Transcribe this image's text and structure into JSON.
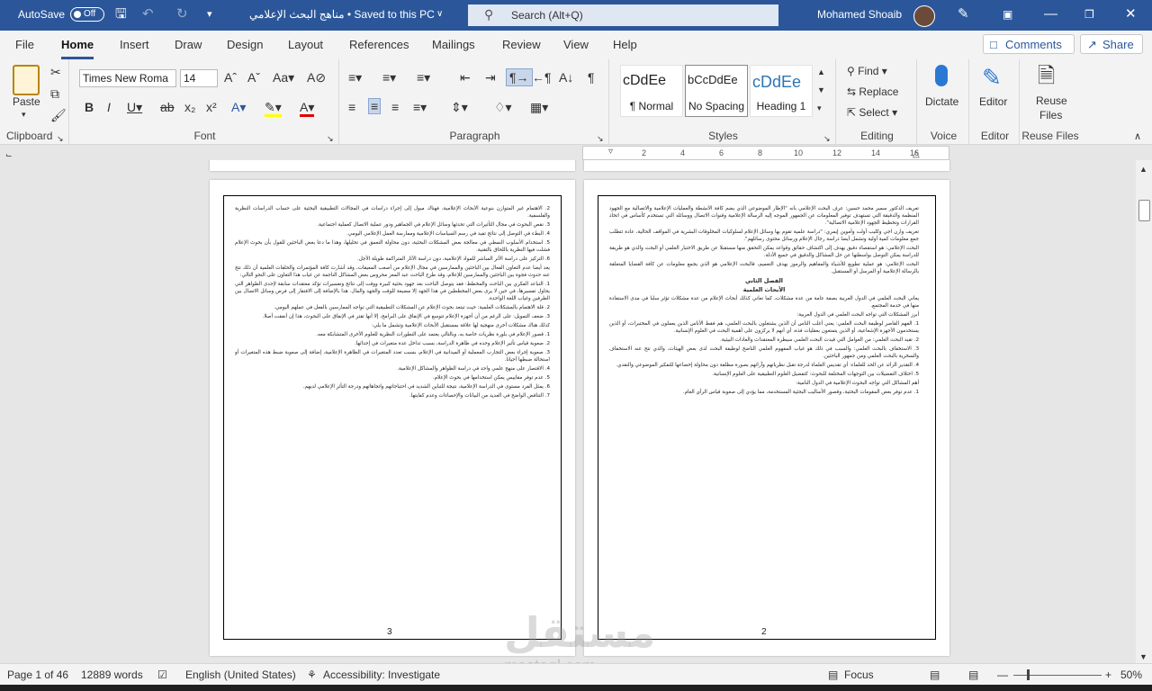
{
  "titlebar": {
    "autosave_label": "AutoSave",
    "autosave_state": "Off",
    "doc_title": "مناهج البحث الإعلامي • Saved to this PC",
    "search_placeholder": "Search (Alt+Q)",
    "user_name": "Mohamed Shoaib"
  },
  "tabs": [
    "File",
    "Home",
    "Insert",
    "Draw",
    "Design",
    "Layout",
    "References",
    "Mailings",
    "Review",
    "View",
    "Help"
  ],
  "active_tab": "Home",
  "buttons": {
    "comments": "Comments",
    "share": "Share"
  },
  "ribbon": {
    "clipboard": {
      "label": "Clipboard",
      "paste": "Paste"
    },
    "font": {
      "label": "Font",
      "font_name": "Times New Roma",
      "font_size": "14"
    },
    "paragraph": {
      "label": "Paragraph"
    },
    "styles": {
      "label": "Styles",
      "items": [
        {
          "preview": "cDdEe",
          "name": "¶ Normal"
        },
        {
          "preview": "bCcDdEe",
          "name": "No Spacing"
        },
        {
          "preview": "cDdEe",
          "name": "Heading 1"
        }
      ]
    },
    "editing": {
      "label": "Editing",
      "find": "Find",
      "replace": "Replace",
      "select": "Select"
    },
    "voice": {
      "label": "Voice",
      "dictate": "Dictate"
    },
    "editor": {
      "label": "Editor",
      "editor": "Editor"
    },
    "reuse": {
      "label": "Reuse Files",
      "reuse1": "Reuse",
      "reuse2": "Files"
    }
  },
  "ruler": {
    "ticks": [
      "2",
      "4",
      "6",
      "8",
      "10",
      "12",
      "14",
      "16"
    ]
  },
  "pages": {
    "left": {
      "number": "3",
      "paragraphs": [
        "2. الاهتمام غير المتوازن بنوعية الأبحاث الإعلامية، فهناك ميول إلى إجراء دراسات في المجالات التطبيقية البحثية على حساب الدراسات النظرية والفلسفية.",
        "3. نقص البحوث في مجال التأثيرات التي تحدثها وسائل الإعلام في الجماهير ودور عملية الاتصال كعملية اجتماعية.",
        "4. البطء في التوصل إلى نتائج تفيد في رسم السياسات الإعلامية وممارسة العمل الإعلامي اليومي.",
        "5. استخدام الأسلوب النمطي في معالجة بعض المشكلات البحثية، دون محاولة التعمق في تحليلها، وهذا ما دعا بعض الباحثين للقول بأن بحوث الإعلام فشلت فيها النظرية باللحاق بالتقنية.",
        "6. التركيز على دراسة الأثر المباشر للمواد الإعلامية، دون دراسة الآثار المتراكمة طويلة الأجل.",
        "يعد أيضا عدم التعاون الفعال بين الباحثين والممارسين في مجال الإعلام من أصعب المعيقات، وقد أشارت كافة المؤتمرات والحلقات العلمية أن ذلك نتج عنه حدوث فجوة بين الباحثين والممارسين للإعلام، وقد طرح الباحث عبد المعز محروس بعض المشاكل الناجمة عن غياب هذا التعاون على النحو التالي:",
        "1. التباعد الفكري بين الباحث والمخطط: فقد يتوصل الباحث بعد جهود بحثية كبيرة ووقت إلى نتائج وتفسيرات تؤكد معتقدات سابقة لإحدى الظواهر التي يحاول تفسيرها، في حين لا يرى بعض المخططين في هذا الجهد إلا مضيعة للوقت والجهد والمال. هذا بالإضافة إلى الافتقار إلى فرص وسائل الاتصال بين الطرفين وغياب اللغة الواحدة.",
        "2. قلة الاهتمام بالمشكلات العلمية: حيث تبتعد بحوث الإعلام عن المشكلات التطبيقية التي تواجه الممارسين بالفعل في عملهم اليومي.",
        "3. ضعف التمويل: على الرغم من أن أجهزة الإعلام تتوسع في الإنفاق على البرامج، إلا أنها تقتر في الإنفاق على البحوث، هذا إن أنفقت أصلا.",
        "كذلك هناك مشكلات أخرى منهجية لها علاقة بمستقبل الأبحاث الإعلامية وتشمل ما يلي:",
        "1. قصور الإعلام في بلورة نظريات خاصة به، وبالتالي يعتمد على التطورات النظرية للعلوم الأخرى المتشابكة معه.",
        "2. صعوبة قياس تأثير الإعلام وحده في ظاهرة الدراسة، بسبب تداخل عدة متغيرات في إحداثها.",
        "3. صعوبة إجراء بعض التجارب المعملية أو الميدانية في الإعلام، بسبب تعدد المتغيرات في الظاهرة الإعلامية، إضافة إلى صعوبة ضبط هذه المتغيرات أو استحالة ضبطها أحيانا.",
        "4. الاقتصار على منهج علمي واحد في دراسة الظواهر والمشاكل الإعلامية.",
        "5. عدم توفر مقاييس يمكن استخدامها في بحوث الإعلام.",
        "6. يمثل الفرد مستوى في الدراسة الإعلامية، نتيجة للتباين الشديد في احتياجاتهم واتجاهاتهم ودرجة التأثر الإعلامي لديهم.",
        "7. التناقض الواضح في العديد من البيانات والإحصاءات وعدم كفايتها."
      ]
    },
    "right": {
      "number": "2",
      "paragraphs": [
        "تعريف الدكتور سمير محمد حسين: عرف البحث الإعلامي بأنه \"الإطار الموضوعي الذي يضم كافة الأنشطة والعمليات الإعلامية والاتصالية مع الجهود المنظمة والدقيقة التي تستهدف توفير المعلومات عن الجمهور الموجه إليه الرسالة الإعلامية وقنوات الاتصال ووسائله التي تستخدم كأساس في اتخاذ القرارات وتخطيط الجهود الإعلامية الاتصالية\".",
        "تعريف وارن اجي وكليب أولت وأموين إيمري: \"دراسة علمية تقوم بها وسائل الإعلام لسلوكيات المخلوقات البشرية في المواقف الحالية، عادة تتطلب جمع معلومات كمية أولية وتشمل أيضا دراسة رجال الإعلام ورسائل محتوى رسائلهم\".",
        "البحث الإعلامي: هو استقصاء دقيق يهدف إلى اكتشاف حقائق وقواعد يمكن التحقق منها مستقبلا عن طريق الاختبار العلمي أو البحث والذي هو طريقة للدراسة يمكن التوصل بواسطتها عن حل المشاكل والدقيق في جميع الأدلة.",
        "البحث الإعلامي: هو عملية تطويع للأشياء والمفاهيم والرموز بهدف التعميم، فالبحث الإعلامي هو الذي يجمع معلومات عن كافة القضايا المتعلقة بالرسالة الإعلامية أو المرسل أو المستقبل.",
        "الفصل الثاني",
        "الأبحاث العلمية",
        "يعاني البحث العلمي في الدول العربية بصفة عامة من عدة مشكلات، كما تعاني كذلك أبحاث الإعلام من عدة مشكلات تؤثر سلبا في مدى الاستفادة منها في خدمة المجتمع.",
        "أبرز المشكلات التي تواجه البحث العلمي في الدول العربية:",
        "1. الفهم القاصر لوظيفة البحث العلمي: يعني أغلب الناس أن الذين يشتغلون بالبحث العلمي، هم فقط الأناس الذين يعملون في المختبرات، أو الذين يستخدمون الأجهزة الإشعاعية، أو الذين يتمتعون بعقليات فذة، أي أنهم لا يركزون على أهمية البحث في العلوم الإنسانية.",
        "2. تقيد البحث العلمي: من العوامل التي قيدت البحث العلمي سيطرة المعتقدات والعادات البيئية.",
        "3. الاستخفاف بالبحث العلمي: والسبب في ذلك هو غياب المفهوم العلمي الناضج لوظيفة البحث لدى بعض الهيئات، والذي نتج عنه الاستخفاف والسخرية بالبحث العلمي ومن جمهور الباحثين.",
        "4. التقدير الزائد عن الحد للعلماء: أي تقديس العلماء لدرجة تقبل نظرياتهم وآرائهم بصورة مطلقة دون محاولة إخضاعها للتفكير الموضوعي والنقدي.",
        "5. اختلاف التفضيلات بين التوجهات المختلفة للبحوث: كتفضيل العلوم التطبيقية على العلوم الإنسانية.",
        "أهم المشاكل التي تواجه البحوث الإعلامية في الدول النامية:",
        "1. عدم توفر بعض المقومات البحثية، وقصور الأساليب البحثية المستخدمة، مما يؤدي إلى صعوبة قياس الرأي العام."
      ]
    }
  },
  "status": {
    "page": "Page 1 of 46",
    "words": "12889 words",
    "language": "English (United States)",
    "accessibility": "Accessibility: Investigate",
    "focus": "Focus",
    "zoom": "50%"
  },
  "watermark": {
    "arabic": "مستقل",
    "latin": "mostaql.com"
  },
  "colors": {
    "titlebar": "#2b579a",
    "accent": "#2b579a"
  }
}
